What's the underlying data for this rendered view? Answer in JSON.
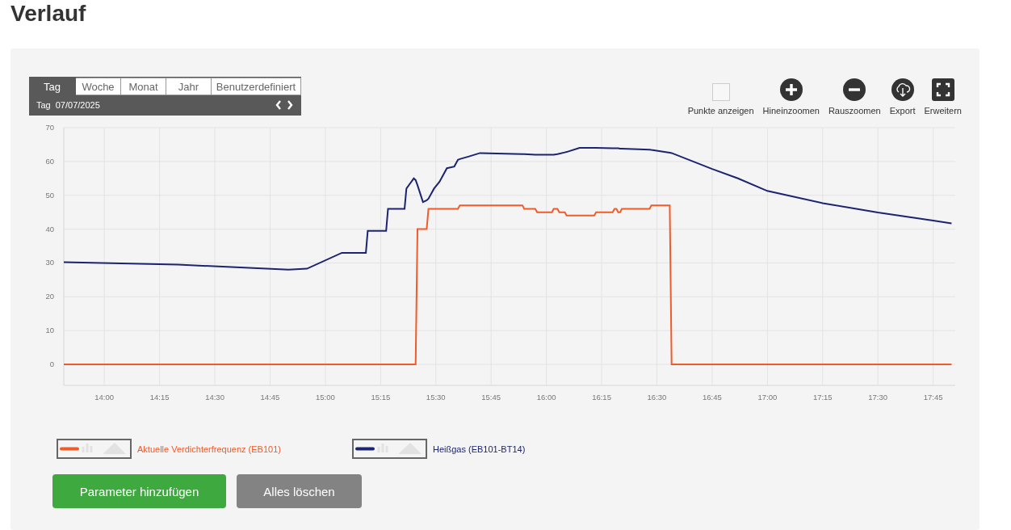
{
  "title": "Verlauf",
  "range_tabs": [
    {
      "label": "Tag",
      "selected": true
    },
    {
      "label": "Woche",
      "selected": false
    },
    {
      "label": "Monat",
      "selected": false
    },
    {
      "label": "Jahr",
      "selected": false
    },
    {
      "label": "Benutzerdefiniert",
      "selected": false
    }
  ],
  "period": {
    "label": "Tag",
    "date": "07/07/2025"
  },
  "toolbar": [
    {
      "kind": "checkbox",
      "label": "Punkte anzeigen",
      "checked": false
    },
    {
      "kind": "zoom_in",
      "label": "Hineinzoomen"
    },
    {
      "kind": "zoom_out",
      "label": "Rauszoomen"
    },
    {
      "kind": "export",
      "label": "Export"
    },
    {
      "kind": "expand",
      "label": "Erweitern"
    }
  ],
  "chart": {
    "chart_data": {
      "type": "line",
      "x": [
        829,
        860,
        890,
        895,
        904.5,
        911,
        911.5,
        916.5,
        917,
        921.5,
        922,
        924,
        924.5,
        925,
        926.5,
        927.5,
        928,
        929.5,
        931,
        933,
        935,
        936,
        936.5,
        939,
        942,
        953.5,
        954,
        957,
        957.5,
        961.5,
        962,
        963,
        963.5,
        965,
        965.5,
        969,
        973,
        973.5,
        978,
        978.5,
        979,
        979.5,
        980,
        980.5,
        988,
        988.5,
        993.5,
        994,
        1005,
        1012,
        1020,
        1035,
        1050,
        1065,
        1070
      ],
      "series": [
        {
          "name": "Aktuelle Verdichterfrequenz (EB101)",
          "color": "#f15a29",
          "values": [
            0,
            0,
            0,
            0,
            0,
            0,
            0,
            0,
            0,
            0,
            0,
            0,
            0,
            40,
            40,
            40,
            46,
            46,
            46,
            46,
            46,
            46,
            47,
            47,
            47,
            47,
            46,
            46,
            45,
            45,
            46,
            46,
            45,
            45,
            44,
            44,
            44,
            45,
            45,
            46,
            46,
            45,
            45,
            46,
            46,
            47,
            47,
            0,
            0,
            0,
            0,
            0,
            0,
            0,
            0
          ]
        },
        {
          "name": "Heißgas (EB101-BT14)",
          "color": "#1c2371",
          "values": [
            30.2,
            29.5,
            28,
            28.3,
            33,
            33,
            39.5,
            39.5,
            46,
            46,
            52,
            55,
            54.5,
            53,
            48,
            48.5,
            49,
            52,
            54,
            58,
            58.5,
            60.5,
            60.7,
            61.5,
            62.5,
            62.2,
            62.2,
            62,
            62,
            62,
            62,
            62.2,
            62.3,
            62.7,
            62.8,
            64,
            64,
            64,
            63.9,
            63.9,
            63.9,
            63.9,
            63.8,
            63.8,
            63.5,
            63.4,
            62.6,
            62.5,
            57.8,
            55,
            51.3,
            47.7,
            44.9,
            42.5,
            41.7
          ]
        }
      ],
      "xlim": [
        829,
        1071
      ],
      "ylim": [
        -6.2,
        70
      ],
      "xticks": [
        {
          "value": 840,
          "label": "14:00"
        },
        {
          "value": 855,
          "label": "14:15"
        },
        {
          "value": 870,
          "label": "14:30"
        },
        {
          "value": 885,
          "label": "14:45"
        },
        {
          "value": 900,
          "label": "15:00"
        },
        {
          "value": 915,
          "label": "15:15"
        },
        {
          "value": 930,
          "label": "15:30"
        },
        {
          "value": 945,
          "label": "15:45"
        },
        {
          "value": 960,
          "label": "16:00"
        },
        {
          "value": 975,
          "label": "16:15"
        },
        {
          "value": 990,
          "label": "16:30"
        },
        {
          "value": 1005,
          "label": "16:45"
        },
        {
          "value": 1020,
          "label": "17:00"
        },
        {
          "value": 1035,
          "label": "17:15"
        },
        {
          "value": 1050,
          "label": "17:30"
        },
        {
          "value": 1065,
          "label": "17:45"
        }
      ],
      "yticks": [
        0,
        10,
        20,
        30,
        40,
        50,
        60,
        70
      ],
      "grid": true
    }
  },
  "buttons": [
    {
      "label": "Parameter hinzufügen",
      "kind": "primary"
    },
    {
      "label": "Alles löschen",
      "kind": "secondary"
    }
  ]
}
